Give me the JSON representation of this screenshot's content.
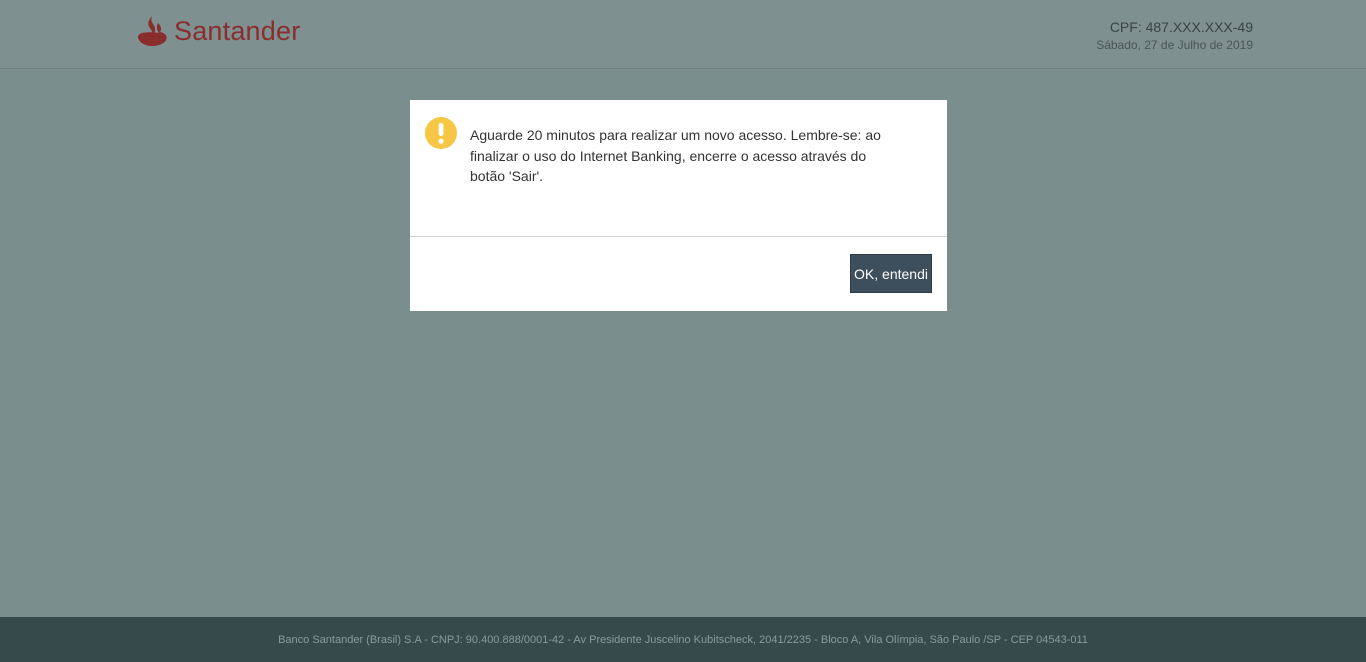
{
  "header": {
    "brand_name": "Santander",
    "cpf": "CPF: 487.XXX.XXX-49",
    "date": "Sábado, 27 de Julho de 2019"
  },
  "dialog": {
    "icon": "warning-icon",
    "message": "Aguarde 20 minutos para realizar um novo acesso. Lembre-se: ao finalizar o uso do Internet Banking, encerre o acesso através do botão 'Sair'.",
    "ok_label": "OK, entendi"
  },
  "footer": {
    "text": "Banco Santander (Brasil) S.A - CNPJ: 90.400.888/0001-42 - Av Presidente Juscelino Kubitscheck, 2041/2235 - Bloco A, Vila Olímpia, São Paulo /SP - CEP 04543-011"
  },
  "colors": {
    "brand": "#8a2d2d",
    "overlay_background": "#7a8e8e",
    "footer_background": "#364a4c",
    "button_background": "#3d4f5c",
    "warning": "#f6c744"
  }
}
